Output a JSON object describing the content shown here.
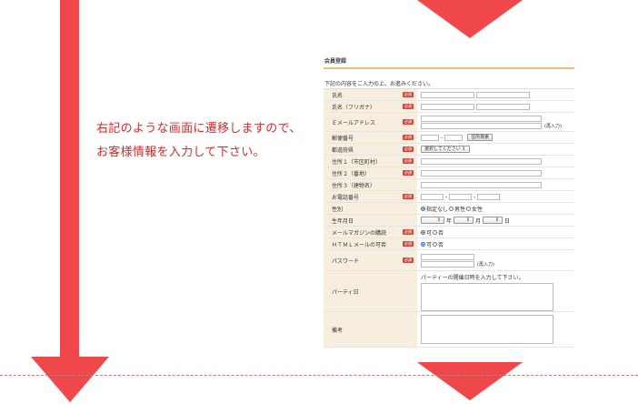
{
  "instructions": {
    "line1": "右記のような画面に遷移しますので、",
    "line2": "お客様情報を入力して下さい。"
  },
  "form": {
    "title": "会員登録",
    "intro": "下記の内容をご入力の上、お進みください。",
    "required_badge": "必須",
    "fields": {
      "name": "氏名",
      "kana": "氏名（フリガナ）",
      "email": "Ｅメールアドレス",
      "postal": "郵便番号",
      "prefecture": "都道府県",
      "addr1": "住所１（市区町村）",
      "addr2": "住所２（番地）",
      "addr3": "住所３（建物名）",
      "phone": "お電話番号",
      "gender": "性別",
      "birthday": "生年月日",
      "mailmag": "メールマガジンの購読",
      "html_mail": "ＨＴＭＬメールの可否",
      "password": "パスワード",
      "party_date": "パーティ日",
      "notes": "備考"
    },
    "reenter": "(再入力)",
    "postal_dash": "-",
    "address_search": "住所検索",
    "prefecture_select": "選択してください",
    "phone_dash": "-",
    "gender_options": [
      "指定なし",
      "男性",
      "女性"
    ],
    "birthday_units": [
      "年",
      "月",
      "日"
    ],
    "yes": "可",
    "no": "否",
    "party_hint": "パーティーの開催日時を入力して下さい。"
  }
}
